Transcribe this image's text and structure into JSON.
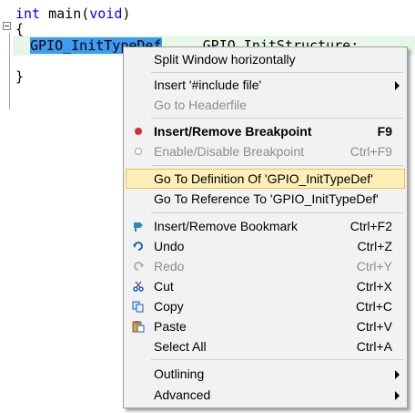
{
  "editor": {
    "line1_type": "int",
    "line1_rest": " main(",
    "line1_param": "void",
    "line1_end": ")",
    "line2": "{",
    "line3_selected": "GPIO_InitTypeDef",
    "line3_rest": "     GPIO_InitStructure;",
    "line4": "}"
  },
  "menu": {
    "split_window": "Split Window horizontally",
    "insert_include": "Insert '#include file'",
    "go_to_headerfile": "Go to Headerfile",
    "insert_remove_breakpoint": "Insert/Remove Breakpoint",
    "insert_remove_breakpoint_sc": "F9",
    "enable_disable_breakpoint": "Enable/Disable Breakpoint",
    "enable_disable_breakpoint_sc": "Ctrl+F9",
    "go_to_definition": "Go To Definition Of 'GPIO_InitTypeDef'",
    "go_to_reference": "Go To Reference To 'GPIO_InitTypeDef'",
    "insert_remove_bookmark": "Insert/Remove Bookmark",
    "insert_remove_bookmark_sc": "Ctrl+F2",
    "undo": "Undo",
    "undo_sc": "Ctrl+Z",
    "redo": "Redo",
    "redo_sc": "Ctrl+Y",
    "cut": "Cut",
    "cut_sc": "Ctrl+X",
    "copy": "Copy",
    "copy_sc": "Ctrl+C",
    "paste": "Paste",
    "paste_sc": "Ctrl+V",
    "select_all": "Select All",
    "select_all_sc": "Ctrl+A",
    "outlining": "Outlining",
    "advanced": "Advanced"
  },
  "colors": {
    "highlight_bg": "#fff0b8",
    "selection_bg": "#3d9bf0",
    "keyword": "#0000ff",
    "breakpoint_red": "#d32f2f"
  }
}
